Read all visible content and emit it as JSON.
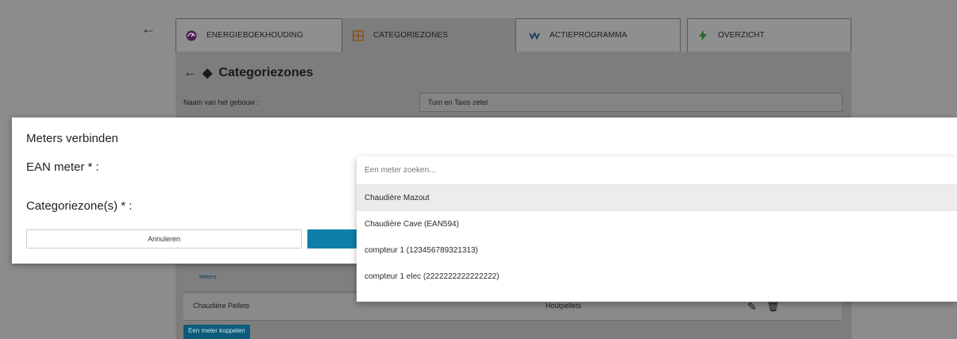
{
  "tabs": [
    {
      "label": "ENERGIEBOEKHOUDING",
      "icon": "gauge-icon",
      "color": "#6a2a6e"
    },
    {
      "label": "CATEGORIEZONES",
      "icon": "grid-zones-icon",
      "color": "#b86a10"
    },
    {
      "label": "ACTIEPROGRAMMA",
      "icon": "wave-icon",
      "color": "#1a3a78"
    },
    {
      "label": "OVERZICHT",
      "icon": "bolt-icon",
      "color": "#2d8a2d"
    }
  ],
  "panel": {
    "title": "Categoriezones",
    "building_label": "Naam van het gebouw :",
    "building_value": "Turn en Taxis zetel"
  },
  "table": {
    "header": "Meters",
    "rows": [
      {
        "meter": "Chaudière Pellets",
        "type": "Houtpellets"
      }
    ],
    "link_button": "Een meter koppelen"
  },
  "modal": {
    "title": "Meters verbinden",
    "ean_label": "EAN meter * :",
    "category_label": "Categoriezone(s) * :",
    "cancel_label": "Annuleren"
  },
  "dropdown": {
    "placeholder": "Een meter zoeken...",
    "options": [
      "Chaudière Mazout",
      "Chaudière Cave (EAN594)",
      "compteur 1 (123456789321313)",
      "compteur 1 elec (2222222222222222)"
    ],
    "highlighted_index": 0
  }
}
